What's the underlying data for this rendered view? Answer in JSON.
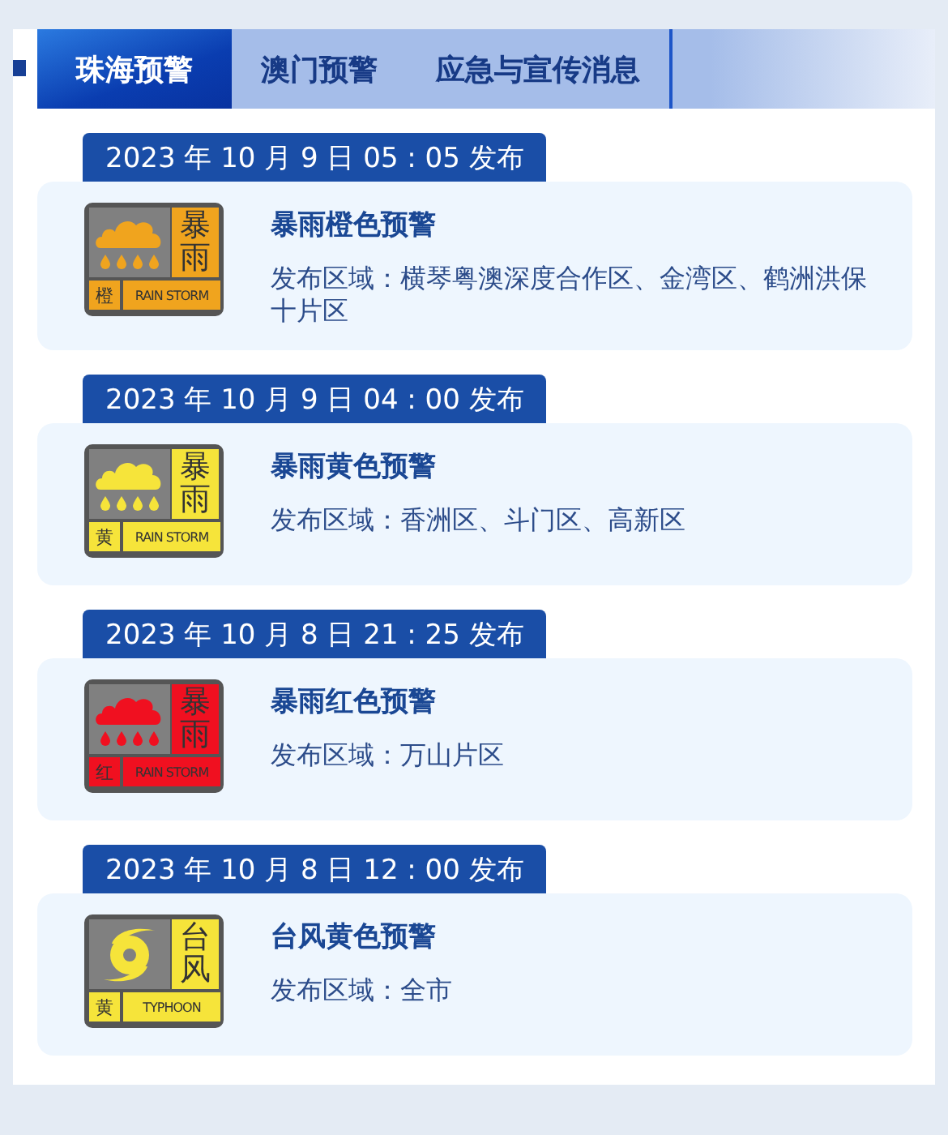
{
  "tabs": [
    {
      "label": "珠海预警",
      "selected": true
    },
    {
      "label": "澳门预警",
      "selected": false
    },
    {
      "label": "应急与宣传消息",
      "selected": false
    }
  ],
  "warnings": [
    {
      "time": "2023 年 10 月 9 日 05 : 05 发布",
      "badge": {
        "kind": "rainstorm",
        "color": "#f0a41e",
        "name": "暴雨",
        "level": "橙",
        "label": "RAIN STORM"
      },
      "title": "暴雨橙色预警",
      "area": "发布区域：横琴粤澳深度合作区、金湾区、鹤洲洪保十片区"
    },
    {
      "time": "2023 年 10 月 9 日 04 : 00 发布",
      "badge": {
        "kind": "rainstorm",
        "color": "#f6e43a",
        "name": "暴雨",
        "level": "黄",
        "label": "RAIN STORM"
      },
      "title": "暴雨黄色预警",
      "area": "发布区域：香洲区、斗门区、高新区"
    },
    {
      "time": "2023 年 10 月 8 日 21 : 25 发布",
      "badge": {
        "kind": "rainstorm",
        "color": "#f01020",
        "name": "暴雨",
        "level": "红",
        "label": "RAIN STORM"
      },
      "title": "暴雨红色预警",
      "area": "发布区域：万山片区"
    },
    {
      "time": "2023 年 10 月 8 日 12 : 00 发布",
      "badge": {
        "kind": "typhoon",
        "color": "#f6e43a",
        "name": "台风",
        "level": "黄",
        "label": "TYPHOON"
      },
      "title": "台风黄色预警",
      "area": "发布区域：全市"
    }
  ]
}
